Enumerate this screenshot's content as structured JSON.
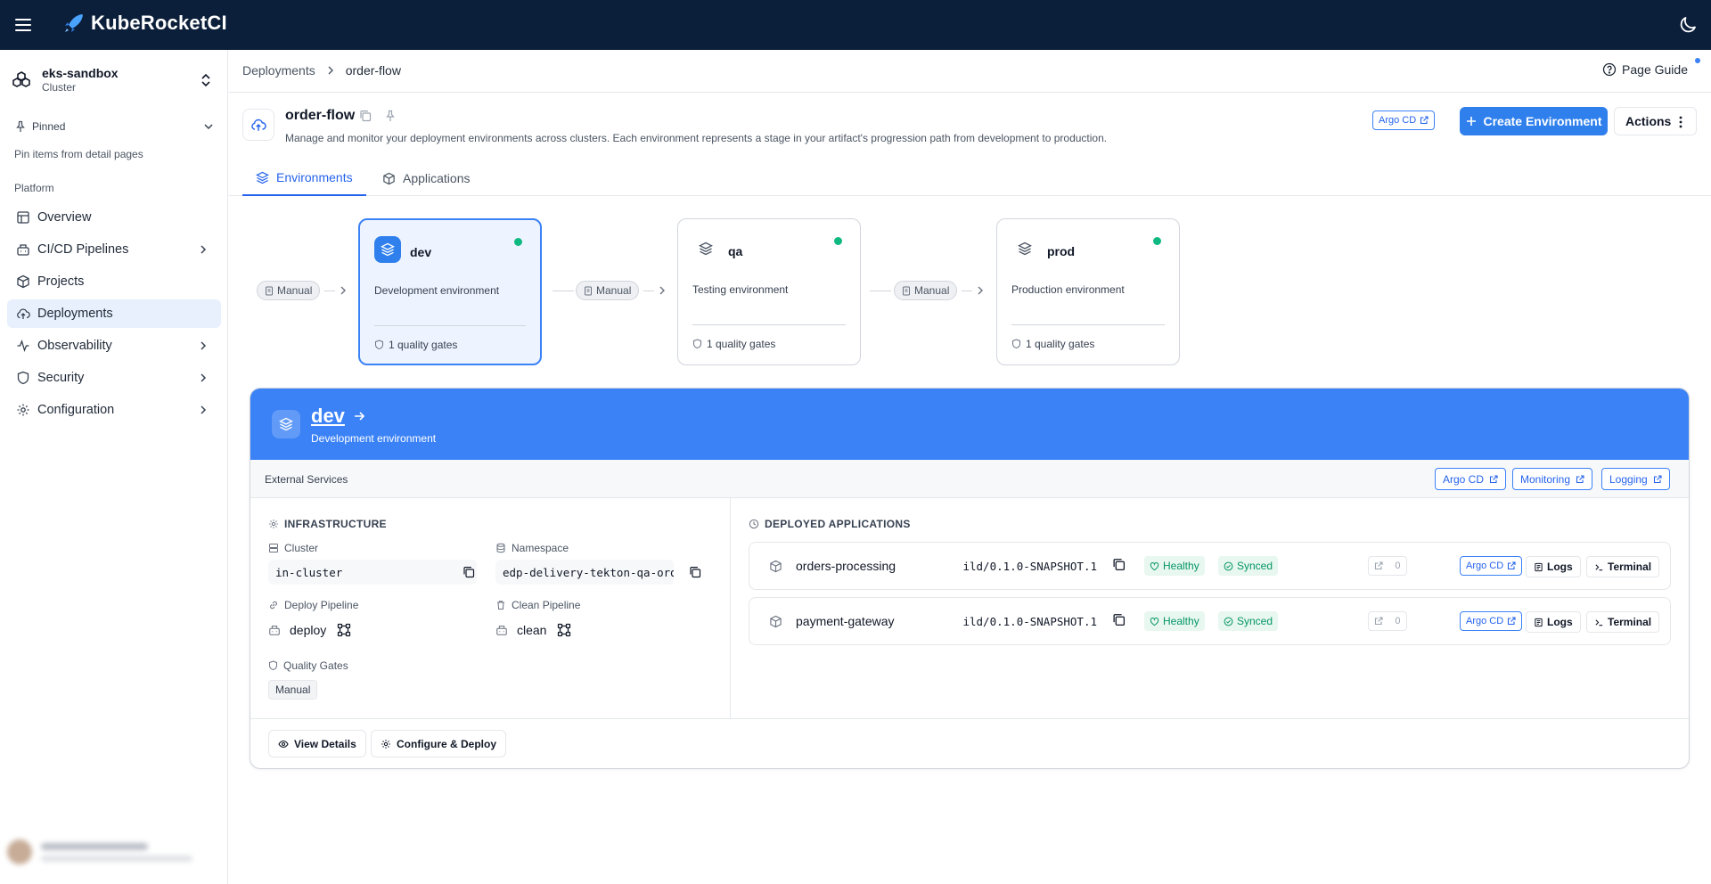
{
  "app": {
    "brand": "KubeRocketCI"
  },
  "sidebar": {
    "cluster_name": "eks-sandbox",
    "cluster_type": "Cluster",
    "pinned_label": "Pinned",
    "pinned_hint": "Pin items from detail pages",
    "section_label": "Platform",
    "items": [
      {
        "label": "Overview",
        "icon": "layout-icon"
      },
      {
        "label": "CI/CD Pipelines",
        "icon": "pipeline-icon"
      },
      {
        "label": "Projects",
        "icon": "box-icon"
      },
      {
        "label": "Deployments",
        "icon": "cloud-upload-icon"
      },
      {
        "label": "Observability",
        "icon": "activity-icon"
      },
      {
        "label": "Security",
        "icon": "shield-icon"
      },
      {
        "label": "Configuration",
        "icon": "gear-icon"
      }
    ]
  },
  "breadcrumb": {
    "parent": "Deployments",
    "current": "order-flow"
  },
  "page_guide": "Page Guide",
  "header": {
    "title": "order-flow",
    "description": "Manage and monitor your deployment environments across clusters. Each environment represents a stage in your artifact's progression path from development to production.",
    "argo_label": "Argo CD",
    "create_label": "Create Environment",
    "actions_label": "Actions"
  },
  "tabs": [
    {
      "label": "Environments",
      "active": true
    },
    {
      "label": "Applications",
      "active": false
    }
  ],
  "pipeline": {
    "manual_label": "Manual",
    "environments": [
      {
        "name": "dev",
        "description": "Development environment",
        "gates": "1 quality gates",
        "status_color": "#10b981",
        "selected": true
      },
      {
        "name": "qa",
        "description": "Testing environment",
        "gates": "1 quality gates",
        "status_color": "#10b981",
        "selected": false
      },
      {
        "name": "prod",
        "description": "Production environment",
        "gates": "1 quality gates",
        "status_color": "#10b981",
        "selected": false
      }
    ]
  },
  "details": {
    "name": "dev",
    "description": "Development environment",
    "external_label": "External Services",
    "external_links": [
      "Argo CD",
      "Monitoring",
      "Logging"
    ],
    "infrastructure": {
      "title": "INFRASTRUCTURE",
      "cluster_label": "Cluster",
      "cluster_value": "in-cluster",
      "namespace_label": "Namespace",
      "namespace_value": "edp-delivery-tekton-qa-orde",
      "deploy_label": "Deploy Pipeline",
      "deploy_value": "deploy",
      "clean_label": "Clean Pipeline",
      "clean_value": "clean",
      "gates_label": "Quality Gates",
      "gates_value": "Manual"
    },
    "apps_title": "DEPLOYED APPLICATIONS",
    "applications": [
      {
        "name": "orders-processing",
        "version": "ild/0.1.0-SNAPSHOT.1",
        "health": "Healthy",
        "sync": "Synced",
        "ext_count": "0",
        "argo": "Argo CD",
        "logs": "Logs",
        "terminal": "Terminal"
      },
      {
        "name": "payment-gateway",
        "version": "ild/0.1.0-SNAPSHOT.1",
        "health": "Healthy",
        "sync": "Synced",
        "ext_count": "0",
        "argo": "Argo CD",
        "logs": "Logs",
        "terminal": "Terminal"
      }
    ],
    "view_details": "View Details",
    "configure_deploy": "Configure & Deploy"
  },
  "colors": {
    "topbar": "#0c1f3a",
    "accent": "#3b82f6",
    "primary_button": "#2f80ed",
    "status_ok": "#10b981"
  }
}
